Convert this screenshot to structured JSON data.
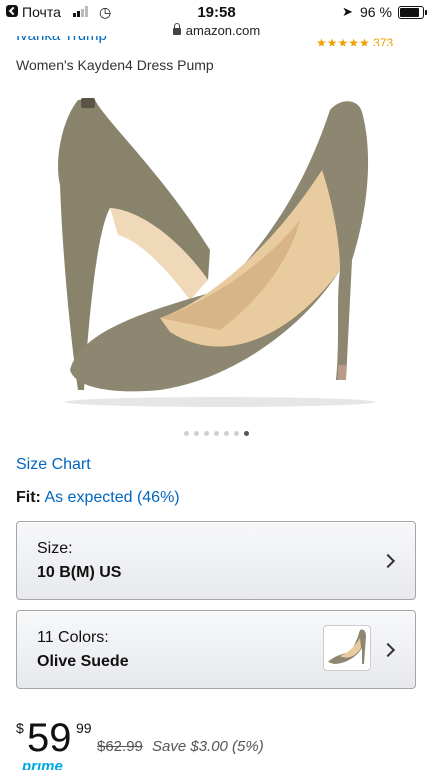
{
  "status": {
    "carrier": "Почта",
    "time": "19:58",
    "battery_pct": "96 %",
    "battery_level": 0.96
  },
  "browser": {
    "url": "amazon.com"
  },
  "product": {
    "brand": "Ivanka Trump",
    "rating_count": "373",
    "title": "Women's Kayden4 Dress Pump",
    "image_count": 7,
    "active_image": 6
  },
  "size_chart": "Size Chart",
  "fit": {
    "label": "Fit:",
    "value": "As expected (46%)"
  },
  "size_selector": {
    "label": "Size:",
    "value": "10 B(M) US"
  },
  "color_selector": {
    "label": "11 Colors:",
    "value": "Olive Suede"
  },
  "price": {
    "symbol": "$",
    "whole": "59",
    "cents": "99",
    "list_price": "$62.99",
    "savings": "Save $3.00 (5%)"
  },
  "prime": "prime",
  "colors": {
    "link": "#0066c0",
    "shoe": "#8d8670",
    "star": "#f0a000"
  }
}
